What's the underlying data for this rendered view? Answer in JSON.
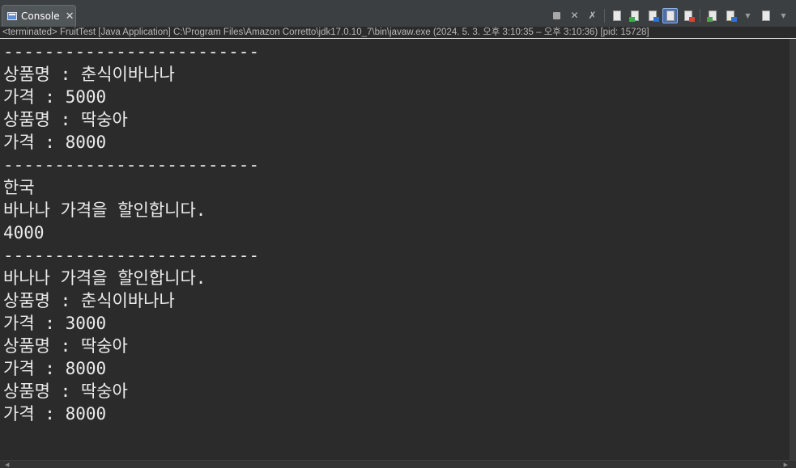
{
  "tab": {
    "label": "Console",
    "close": "✕"
  },
  "toolbar": {
    "icons": [
      "terminate-icon",
      "remove-launch-icon",
      "remove-all-terminated-icon",
      "scroll-lock-icon",
      "word-wrap-icon",
      "show-on-stdout-icon",
      "show-on-stderr-icon",
      "pin-console-icon",
      "display-selected-console-icon",
      "open-console-icon"
    ]
  },
  "process_info": "<terminated> FruitTest [Java Application] C:\\Program Files\\Amazon Corretto\\jdk17.0.10_7\\bin\\javaw.exe  (2024. 5. 3. 오후 3:10:35 – 오후 3:10:36) [pid: 15728]",
  "output_lines": [
    "-------------------------",
    "상품명 : 춘식이바나나",
    "가격 : 5000",
    "상품명 : 딱숭아",
    "가격 : 8000",
    "-------------------------",
    "한국",
    "바나나 가격을 할인합니다.",
    "4000",
    "-------------------------",
    "바나나 가격을 할인합니다.",
    "상품명 : 춘식이바나나",
    "가격 : 3000",
    "상품명 : 딱숭아",
    "가격 : 8000",
    "상품명 : 딱숭아",
    "가격 : 8000"
  ],
  "colors": {
    "background": "#2b2b2b",
    "text": "#ebebeb",
    "tab_bg": "#515658",
    "active_button": "#4b6ea8"
  }
}
